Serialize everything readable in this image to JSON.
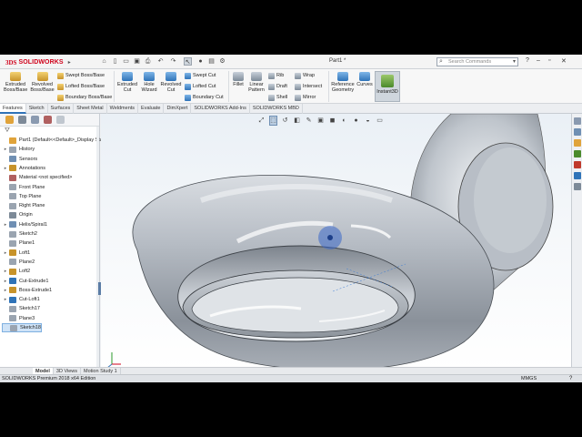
{
  "app": {
    "logo_ds": "3DS",
    "logo_text": "SOLIDWORKS",
    "document_title": "Part1 *",
    "search_placeholder": "Search Commands"
  },
  "ribbon": {
    "extruded_boss": [
      "Extruded",
      "Boss/Base"
    ],
    "revolved_boss": [
      "Revolved",
      "Boss/Base"
    ],
    "swept_boss": "Swept Boss/Base",
    "lofted_boss": "Lofted Boss/Base",
    "boundary_boss": "Boundary Boss/Base",
    "extruded_cut": [
      "Extruded",
      "Cut"
    ],
    "hole_wizard": [
      "Hole",
      "Wizard"
    ],
    "revolved_cut": [
      "Revolved",
      "Cut"
    ],
    "swept_cut": "Swept Cut",
    "lofted_cut": "Lofted Cut",
    "boundary_cut": "Boundary Cut",
    "fillet": "Fillet",
    "linear_pattern": [
      "Linear",
      "Pattern"
    ],
    "rib": "Rib",
    "draft": "Draft",
    "shell": "Shell",
    "wrap": "Wrap",
    "intersect": "Intersect",
    "mirror": "Mirror",
    "reference_geometry": [
      "Reference",
      "Geometry"
    ],
    "curves": "Curves",
    "instant3d": "Instant3D"
  },
  "tabs": [
    "Features",
    "Sketch",
    "Surfaces",
    "Sheet Metal",
    "Weldments",
    "Evaluate",
    "DimXpert",
    "SOLIDWORKS Add-Ins",
    "SOLIDWORKS MBD"
  ],
  "active_tab": "Features",
  "feature_tree": [
    {
      "label": "Part1  (Default<<Default>_Display Sta",
      "expand": ""
    },
    {
      "label": "History",
      "expand": "▸"
    },
    {
      "label": "Sensors",
      "expand": ""
    },
    {
      "label": "Annotations",
      "expand": "▸"
    },
    {
      "label": "Material <not specified>",
      "expand": ""
    },
    {
      "label": "Front Plane",
      "expand": ""
    },
    {
      "label": "Top Plane",
      "expand": ""
    },
    {
      "label": "Right Plane",
      "expand": ""
    },
    {
      "label": "Origin",
      "expand": ""
    },
    {
      "label": "Helix/Spiral1",
      "expand": "▸"
    },
    {
      "label": "Sketch2",
      "expand": ""
    },
    {
      "label": "Plane1",
      "expand": ""
    },
    {
      "label": "Loft1",
      "expand": "▸"
    },
    {
      "label": "Plane2",
      "expand": ""
    },
    {
      "label": "Loft2",
      "expand": "▸"
    },
    {
      "label": "Cut-Extrude1",
      "expand": "▸"
    },
    {
      "label": "Boss-Extrude1",
      "expand": "▸"
    },
    {
      "label": "Cut-Loft1",
      "expand": "▸"
    },
    {
      "label": "Sketch17",
      "expand": ""
    },
    {
      "label": "Plane3",
      "expand": ""
    },
    {
      "label": "Sketch18",
      "expand": "",
      "selected": true
    }
  ],
  "bottom_tabs": [
    "Model",
    "3D Views",
    "Motion Study 1"
  ],
  "active_bottom_tab": "Model",
  "status": {
    "edition": "SOLIDWORKS Premium 2018 x64 Edition",
    "units": "MMGS",
    "help": "?"
  },
  "colors": {
    "brand_red": "#d0021b",
    "selection_blue": "#cfe3f7",
    "model_gray": "#9aa0a8"
  }
}
